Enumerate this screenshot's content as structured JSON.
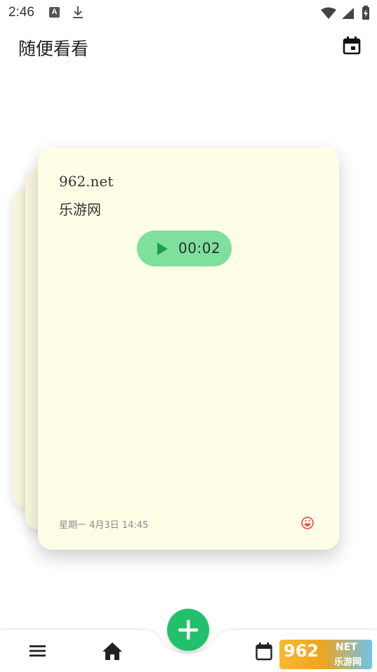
{
  "status_bar": {
    "time": "2:46",
    "a_badge": "A"
  },
  "header": {
    "title": "随便看看"
  },
  "card": {
    "line1": "962.net",
    "line2": "乐游网",
    "audio_time": "00:02",
    "date": "星期一 4月3日 14:45"
  },
  "watermark": {
    "number": "962",
    "net": "NET",
    "cn": "乐游网"
  },
  "colors": {
    "accent": "#22c06a",
    "audio_pill": "#7fdf9d",
    "card_bg": "#fefee6",
    "mood": "#e85a5a"
  }
}
